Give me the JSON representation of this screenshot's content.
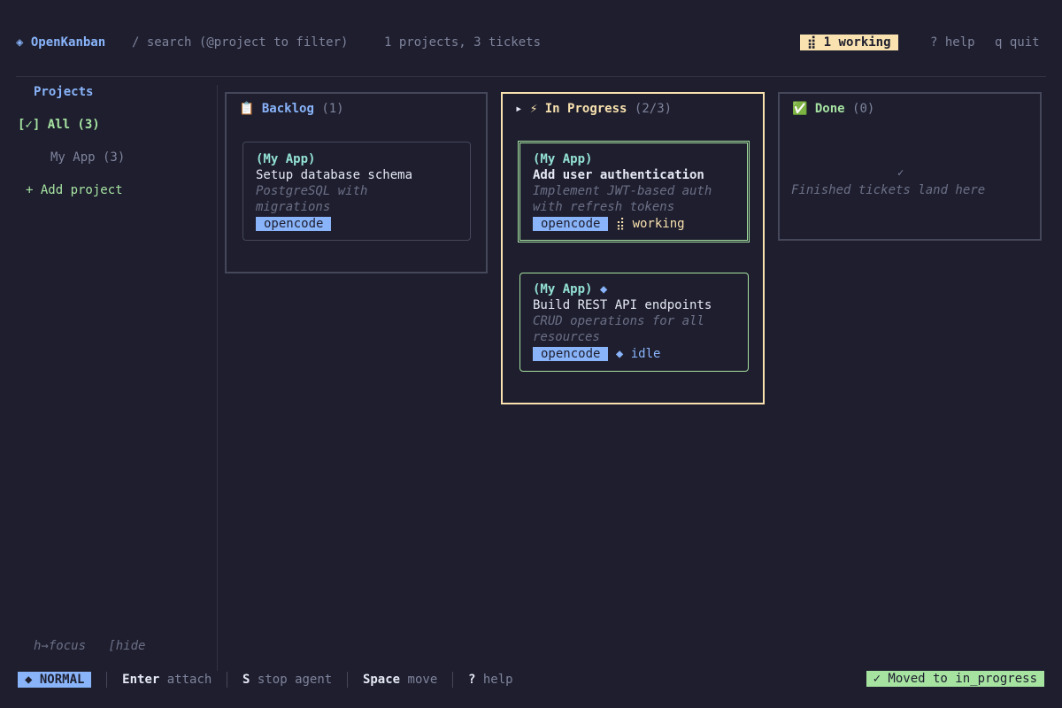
{
  "header": {
    "logo_icon": "◈",
    "app_name": "OpenKanban",
    "search_hint": "/ search (@project to filter)",
    "summary": "1 projects, 3 tickets",
    "working_badge": "⣾  1 working",
    "help": "? help",
    "quit": "q quit"
  },
  "sidebar": {
    "title": "Projects",
    "all_item": "[✓] All (3)",
    "project_item": "My App (3)",
    "add_project": "+ Add project",
    "hint_focus": "h→focus",
    "hint_hide": "[hide"
  },
  "columns": [
    {
      "icon": "📋",
      "title": "Backlog",
      "count": "(1)",
      "cards": [
        {
          "project": "(My App)",
          "title": "Setup database schema",
          "desc_line1": "PostgreSQL with",
          "desc_line2": "migrations",
          "agent": "opencode"
        }
      ]
    },
    {
      "marker": "▸",
      "icon": "⚡",
      "title": "In Progress",
      "count": "(2/3)",
      "cards": [
        {
          "project": "(My App)",
          "title": "Add user authentication",
          "desc_line1": "Implement JWT-based auth",
          "desc_line2": "with refresh tokens",
          "agent": "opencode",
          "status_icon": "⣾",
          "status": "working"
        },
        {
          "project": "(My App)",
          "project_icon": "◆",
          "title": "Build REST API endpoints",
          "desc_line1": "CRUD operations for all",
          "desc_line2": "resources",
          "agent": "opencode",
          "status": "◆ idle"
        }
      ]
    },
    {
      "icon": "✅",
      "title": "Done",
      "count": "(0)",
      "empty_icon": "✓",
      "empty_text": "Finished tickets land here"
    }
  ],
  "footer": {
    "mode": "◆ NORMAL",
    "keys": [
      {
        "key": "Enter",
        "desc": "attach"
      },
      {
        "key": "S",
        "desc": "stop agent"
      },
      {
        "key": "Space",
        "desc": "move"
      },
      {
        "key": "?",
        "desc": "help"
      }
    ],
    "toast": "✓ Moved to in_progress"
  },
  "colors": {
    "background": "#1e1e2e",
    "accent_blue": "#89b4fa",
    "accent_yellow": "#f9e2af",
    "accent_green": "#a6e3a1",
    "accent_teal": "#94e2d5"
  }
}
